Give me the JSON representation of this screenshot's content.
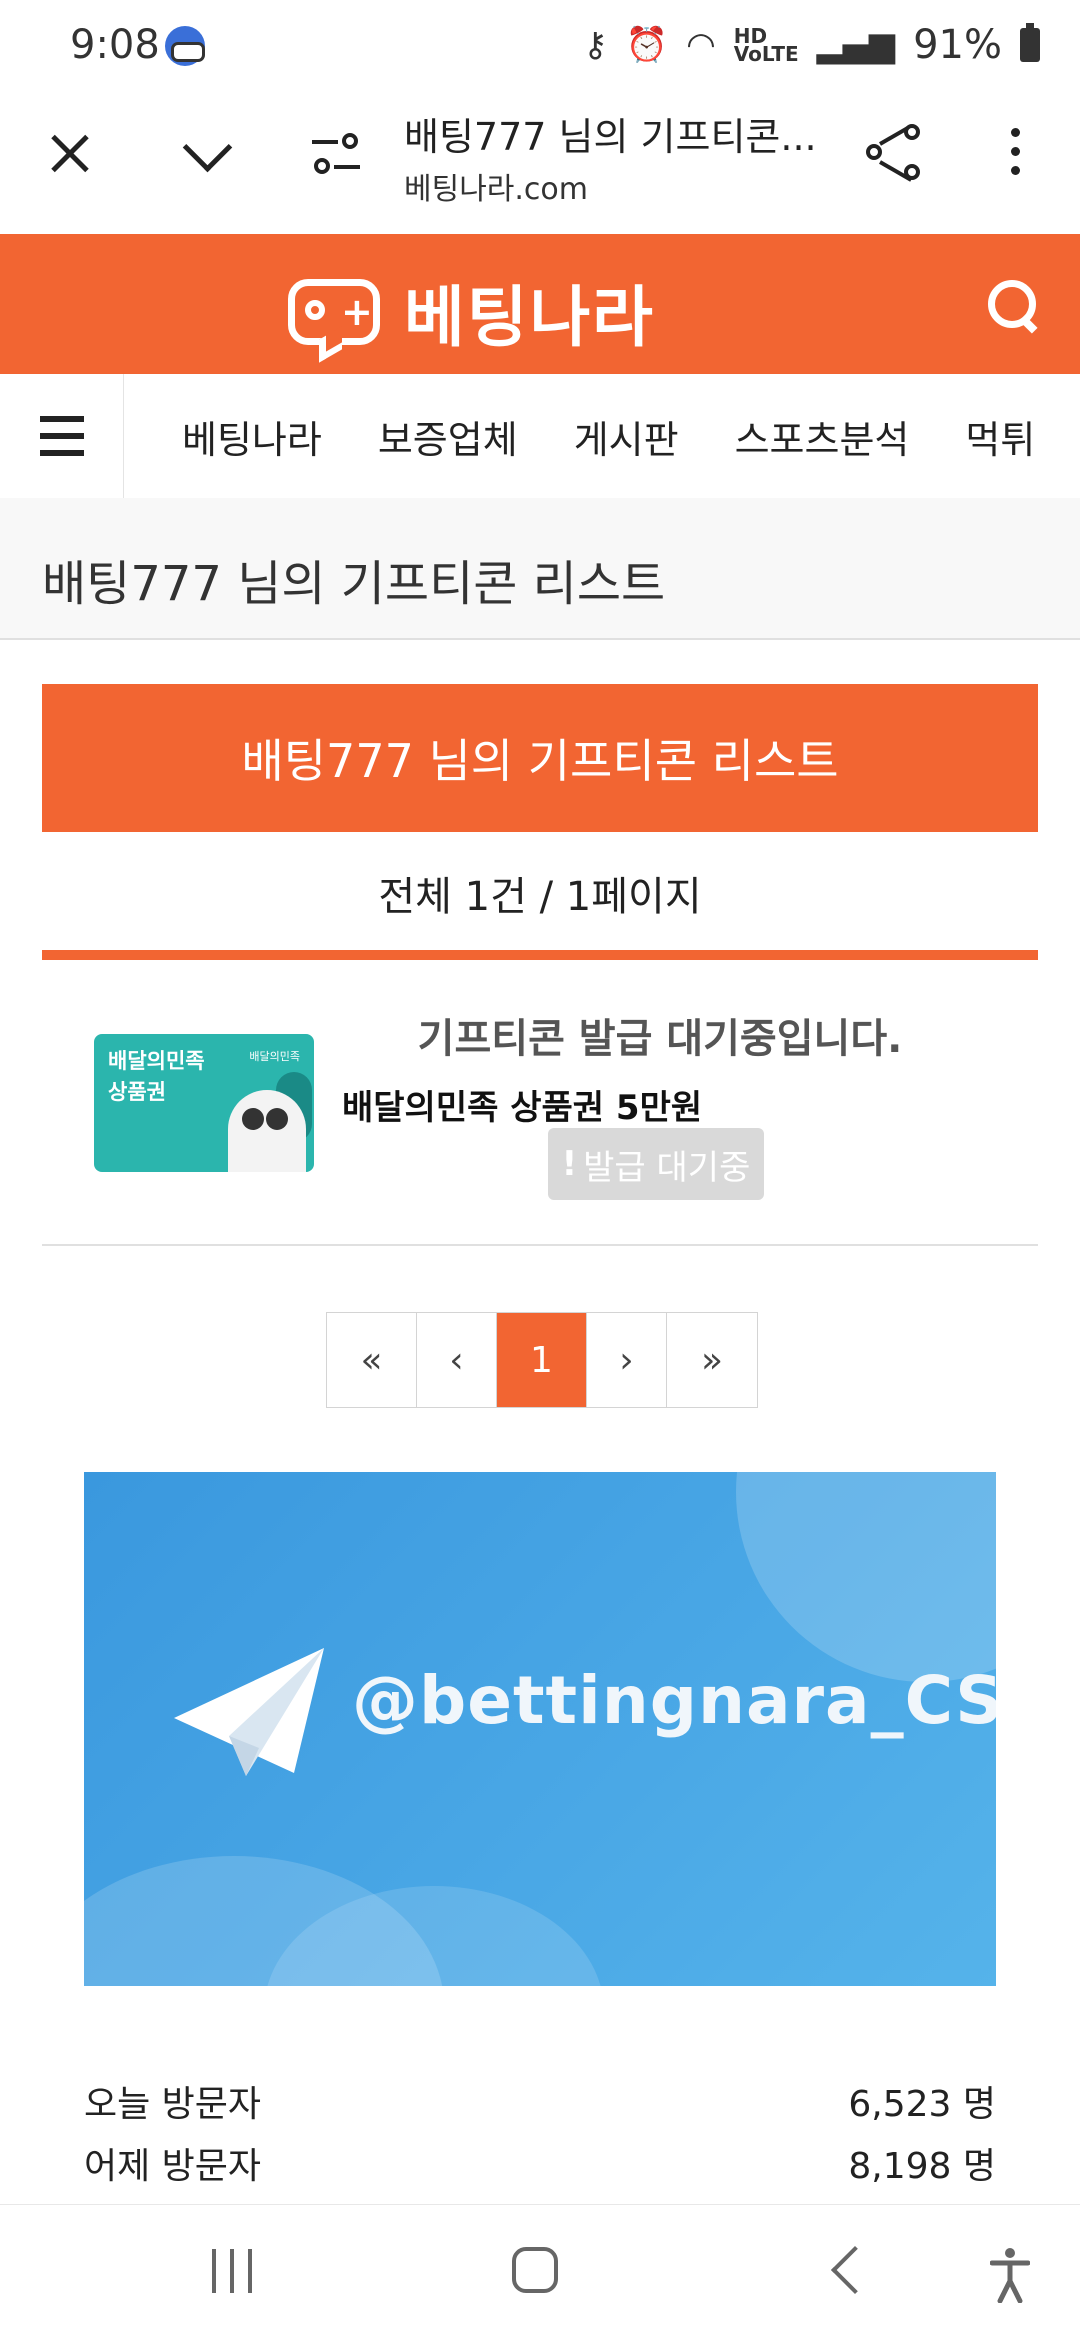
{
  "status_bar": {
    "time": "9:08",
    "battery": "91%",
    "icons": [
      "vpn-key-icon",
      "alarm-icon",
      "wifi-icon",
      "hd-voice-icon",
      "signal-icon",
      "battery-icon"
    ]
  },
  "browser": {
    "tab_title": "배팅777 님의 기프티콘...",
    "url": "베팅나라.com",
    "icons": [
      "close-icon",
      "chevron-down-icon",
      "tune-icon",
      "share-icon",
      "more-vert-icon"
    ]
  },
  "site": {
    "logo_text": "베팅나라",
    "accent_color": "#f26532"
  },
  "nav": {
    "items": [
      "베팅나라",
      "보증업체",
      "게시판",
      "스포츠분석",
      "먹튀"
    ]
  },
  "page": {
    "title": "배팅777 님의 기프티콘 리스트",
    "banner": "배팅777 님의 기프티콘 리스트",
    "count": "전체 1건 / 1페이지"
  },
  "item": {
    "card_label_line1": "배달의민족",
    "card_label_line2": "상품권",
    "card_brand": "배달의민족",
    "status_message": "기프티콘 발급 대기중입니다.",
    "name": "배달의민족 상품권 5만원",
    "badge_icon": "!",
    "badge": "발급 대기중"
  },
  "pagination": {
    "first": "«",
    "prev": "‹",
    "current": "1",
    "next": "›",
    "last": "»"
  },
  "telegram": {
    "handle": "@bettingnara_CS"
  },
  "visitors": {
    "today_label": "오늘 방문자",
    "today_value": "6,523 명",
    "yesterday_label": "어제 방문자",
    "yesterday_value": "8,198 명"
  }
}
